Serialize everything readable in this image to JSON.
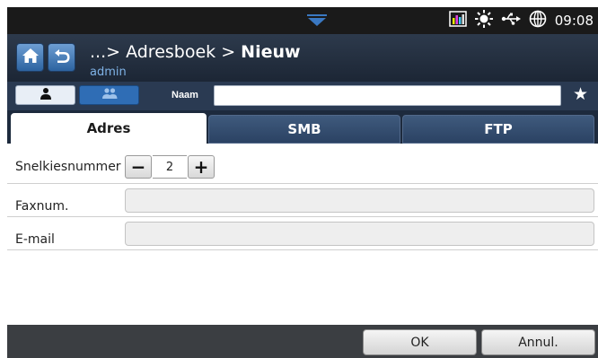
{
  "status_bar": {
    "time": "09:08",
    "icons": [
      "dropdown-arrow-icon",
      "toner-level-icon",
      "brightness-icon",
      "usb-icon",
      "network-icon"
    ]
  },
  "header": {
    "breadcrumb_prefix": "...> Adresboek > ",
    "breadcrumb_current": "Nieuw",
    "user": "admin",
    "accent_color": "#3a78c2"
  },
  "name_row": {
    "label": "Naam",
    "value": "",
    "star": "★"
  },
  "tabs": [
    {
      "label": "Adres",
      "active": true
    },
    {
      "label": "SMB",
      "active": false
    },
    {
      "label": "FTP",
      "active": false
    }
  ],
  "fields": {
    "speed_dial": {
      "label": "Snelkiesnummer",
      "value": "2",
      "minus": "−",
      "plus": "+"
    },
    "fax": {
      "label": "Faxnum.",
      "value": ""
    },
    "email": {
      "label": "E-mail",
      "value": ""
    }
  },
  "actions": {
    "ok": "OK",
    "cancel": "Annul."
  }
}
